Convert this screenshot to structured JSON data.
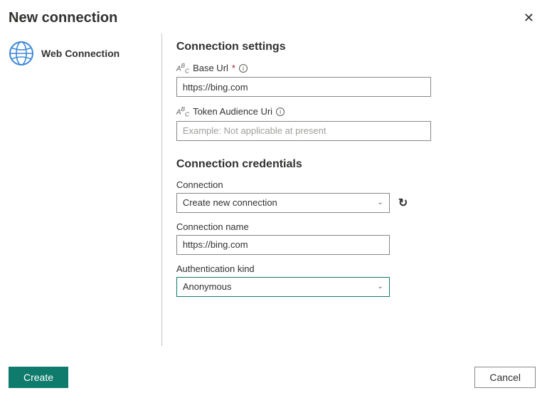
{
  "header": {
    "title": "New connection"
  },
  "leftPanel": {
    "connectionTypeLabel": "Web Connection"
  },
  "settings": {
    "sectionTitle": "Connection settings",
    "baseUrl": {
      "label": "Base Url",
      "required": "*",
      "value": "https://bing.com"
    },
    "tokenAudience": {
      "label": "Token Audience Uri",
      "placeholder": "Example: Not applicable at present",
      "value": ""
    }
  },
  "credentials": {
    "sectionTitle": "Connection credentials",
    "connection": {
      "label": "Connection",
      "selected": "Create new connection"
    },
    "connectionName": {
      "label": "Connection name",
      "value": "https://bing.com"
    },
    "authKind": {
      "label": "Authentication kind",
      "selected": "Anonymous"
    }
  },
  "footer": {
    "create": "Create",
    "cancel": "Cancel"
  }
}
